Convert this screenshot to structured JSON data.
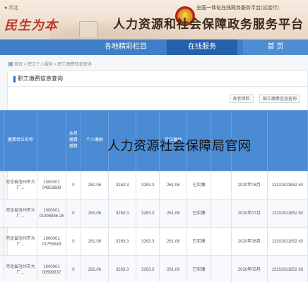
{
  "header": {
    "region": "河北",
    "calligraphy": "民生为本",
    "subtitle": "全国一体化在线政务服务平台(试运行)",
    "title": "人力资源和社会保障政务服务平台"
  },
  "nav": {
    "items": [
      {
        "label": "首  页"
      },
      {
        "label": "在线服务"
      },
      {
        "label": "各地精彩栏目"
      }
    ]
  },
  "breadcrumb": "首页 > 职工个人服务 > 职工缴费信息查询",
  "panel": {
    "title": "职工缴费信息查询"
  },
  "subtabs": [
    "养老保险",
    "职工缴费信息查询"
  ],
  "table": {
    "columns": [
      "",
      "缴费单位名称",
      "",
      "本月缴费基数",
      "个人缴纳",
      "",
      "",
      "单位缴纳",
      "",
      "",
      "",
      ""
    ],
    "rows": [
      {
        "id": "1000001 04953888",
        "unit": "河北省沧州市大厂...",
        "flag": "0",
        "a": "261.06",
        "b": "3263.3",
        "c": "261.06",
        "status": "已实缴",
        "month": "2020年08月",
        "account": "13102811852 63"
      },
      {
        "id": "1000001 01398886 26",
        "unit": "河北省沧州市大厂...",
        "flag": "0",
        "a": "261.06",
        "b": "3263.3",
        "c": "261.06",
        "status": "已实缴",
        "month": "2020年07月",
        "account": "13102811852 63"
      },
      {
        "id": "1000001 01755949",
        "unit": "河北省沧州市大厂...",
        "flag": "0",
        "a": "261.06",
        "b": "3263.3",
        "c": "261.06",
        "status": "已实缴",
        "month": "2020年06月",
        "account": "13102811852 63"
      },
      {
        "id": "1000001 00599337",
        "unit": "河北省沧州市大厂...",
        "flag": "0",
        "a": "261.06",
        "b": "3263.3",
        "c": "261.06",
        "status": "已实缴",
        "month": "2020年05月",
        "account": "13102811852 63"
      }
    ]
  },
  "watermark": "人力资源社会保障局官网"
}
